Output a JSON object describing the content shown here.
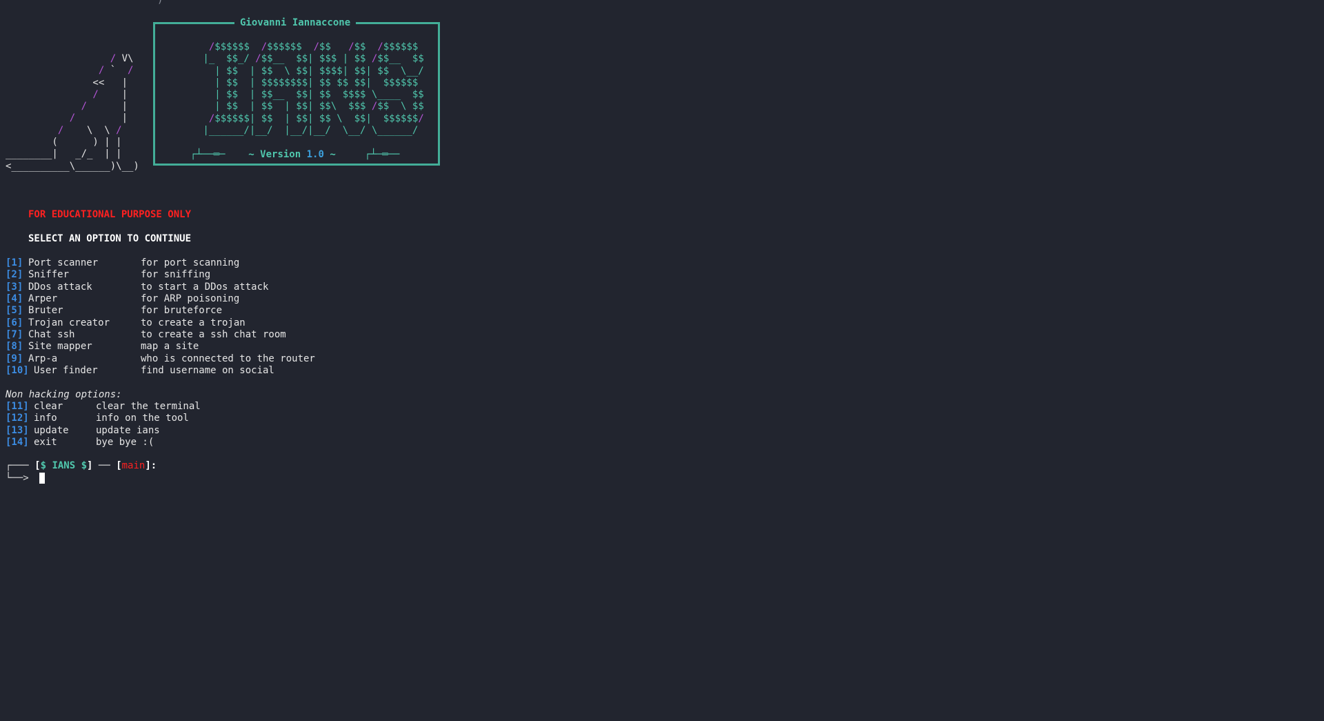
{
  "terminal": {
    "top_fragment": ")",
    "banner": {
      "author": "Giovanni Iannaccone",
      "version_prefix": "~ Version ",
      "version_number": "1.0",
      "version_suffix": " ~",
      "left_decor": "┌┴──═─",
      "right_decor": "┌┴─═──"
    },
    "notice": "FOR EDUCATIONAL PURPOSE ONLY",
    "select_prompt": "SELECT AN OPTION TO CONTINUE",
    "hacking_options": [
      {
        "num": "[1]",
        "name": "Port scanner",
        "desc": "for port scanning"
      },
      {
        "num": "[2]",
        "name": "Sniffer",
        "desc": "for sniffing"
      },
      {
        "num": "[3]",
        "name": "DDos attack",
        "desc": "to start a DDos attack"
      },
      {
        "num": "[4]",
        "name": "Arper",
        "desc": "for ARP poisoning"
      },
      {
        "num": "[5]",
        "name": "Bruter",
        "desc": "for bruteforce"
      },
      {
        "num": "[6]",
        "name": "Trojan creator",
        "desc": "to create a trojan"
      },
      {
        "num": "[7]",
        "name": "Chat ssh",
        "desc": "to create a ssh chat room"
      },
      {
        "num": "[8]",
        "name": "Site mapper",
        "desc": "map a site"
      },
      {
        "num": "[9]",
        "name": "Arp-a",
        "desc": "who is connected to the router"
      },
      {
        "num": "[10]",
        "name": "User finder",
        "desc": "find username on social"
      }
    ],
    "non_hacking_header": "Non hacking options:",
    "non_hacking_options": [
      {
        "num": "[11]",
        "name": "clear",
        "desc": "clear the terminal"
      },
      {
        "num": "[12]",
        "name": "info",
        "desc": "info on the tool"
      },
      {
        "num": "[13]",
        "name": "update",
        "desc": "update ians"
      },
      {
        "num": "[14]",
        "name": "exit",
        "desc": "bye bye :("
      }
    ],
    "prompt": {
      "tree_top": "┌─── ",
      "open1": "[",
      "name": "$ IANS $",
      "close1": "]",
      "sep": " ── ",
      "open2": "[",
      "branch": "main",
      "close2": "]:",
      "tree_bottom": "└──> "
    }
  },
  "colors": {
    "background": "#22252f",
    "teal": "#50c7ad",
    "purple": "#b455d6",
    "red": "#ff2020",
    "blue": "#3c8ce2"
  }
}
